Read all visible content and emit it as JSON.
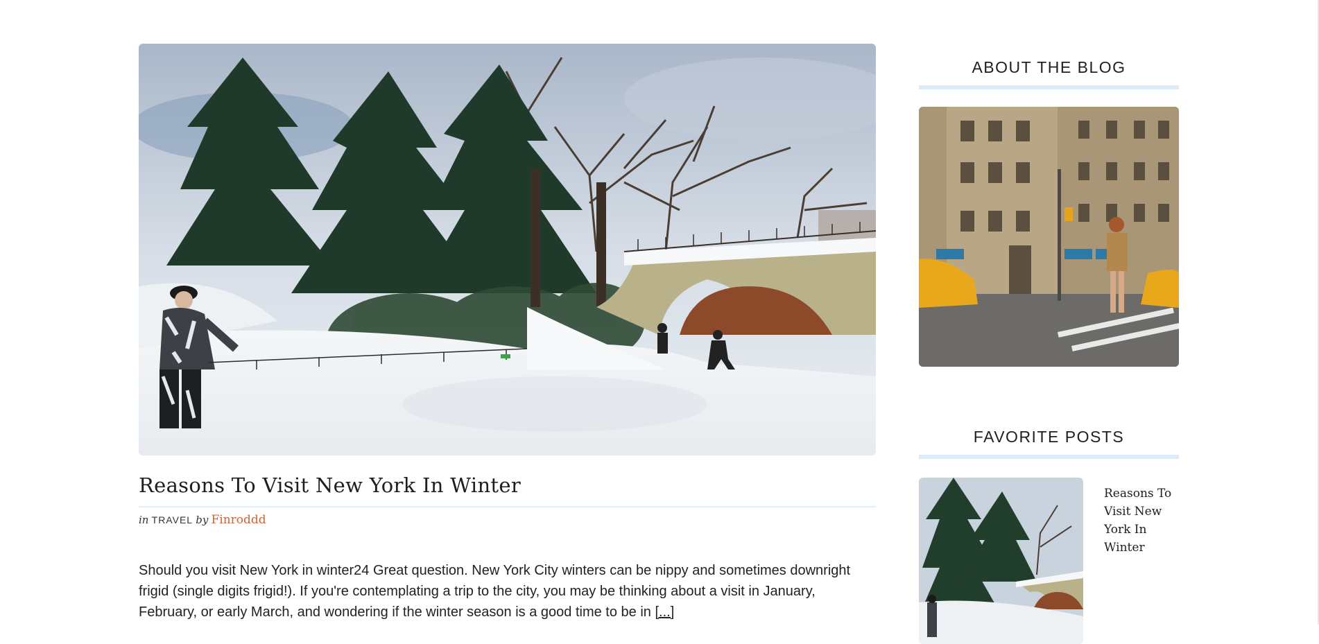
{
  "post": {
    "title": "Reasons To Visit New York In Winter",
    "meta_in": "in",
    "category": "TRAVEL",
    "meta_by": "by",
    "author": "Finroddd",
    "excerpt": "Should you visit New York in winter24 Great question. New York City winters can be nippy and sometimes downright frigid (single digits frigid!). If you're contemplating a trip to the city, you may be thinking about a visit in January, February, or early March, and wondering if the winter season is a good time to be in",
    "more_link": "[...]"
  },
  "sidebar": {
    "about_title": "ABOUT THE BLOG",
    "favorites_title": "FAVORITE POSTS",
    "favorites": [
      {
        "title": "Reasons To Visit New York In Winter"
      }
    ]
  },
  "colors": {
    "accent_rule": "#dcebf7",
    "author_link": "#c8653a",
    "text": "#222222"
  },
  "icons": {
    "hero_image": "snowy-park-bridge-photo",
    "about_image": "city-street-woman-photo",
    "favorite_thumb": "snowy-park-bridge-thumb"
  }
}
